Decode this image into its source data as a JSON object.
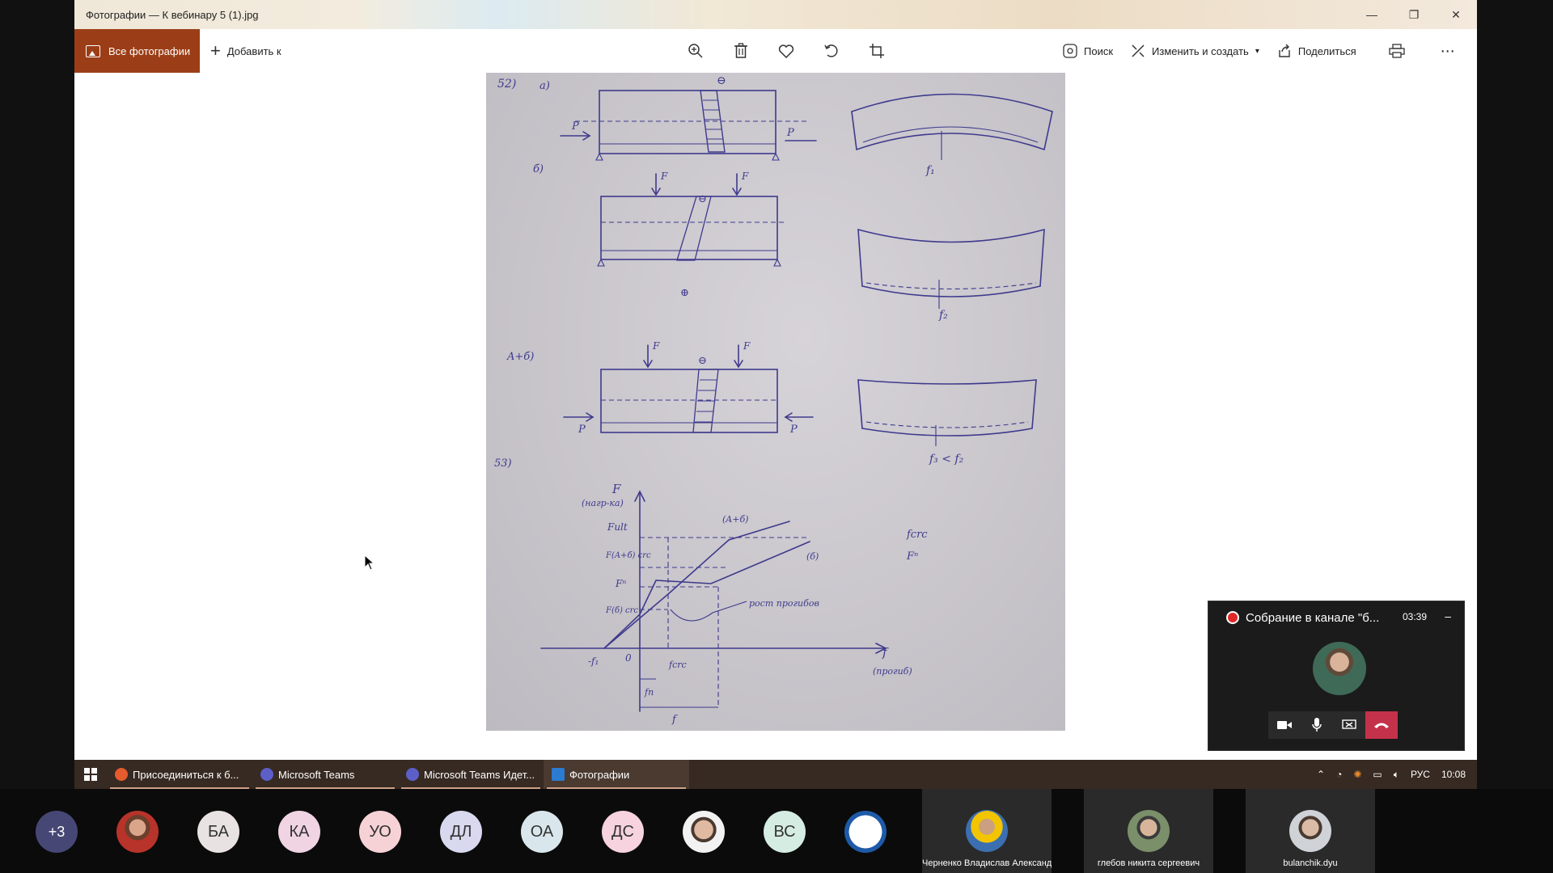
{
  "window": {
    "title": "Фотографии — К вебинару 5 (1).jpg",
    "controls": [
      "—",
      "❐",
      "✕"
    ]
  },
  "toolbar": {
    "all_photos_label": "Все фотографии",
    "add_to_label": "Добавить к",
    "search_label": "Поиск",
    "edit_create_label": "Изменить и создать",
    "share_label": "Поделиться"
  },
  "photo": {
    "labels": {
      "n52": "52)",
      "a": "a)",
      "b": "б)",
      "ab": "A+б)",
      "n53": "53)",
      "theta": "⊖",
      "plus": "⊕",
      "P": "P",
      "F": "F",
      "f1": "f₁",
      "f2": "f₂",
      "f3f2": "f₃ < f₂",
      "axis_F": "F",
      "axis_F_note": "(нагр-ка)",
      "Fult": "Fult",
      "Fcrc_ab": "F(A+б) crc",
      "Fn": "Fⁿ",
      "Fcrc_b": "F(б) crc",
      "ab_curve": "(A+б)",
      "b_curve": "(б)",
      "rost": "рост прогибов",
      "axis_f": "f",
      "axis_f_note": "(прогиб)",
      "minus_f1": "-f₁",
      "zero": "0",
      "fcrc": "fcrc",
      "fn": "fn",
      "f_bottom": "f",
      "side_fcrc": "fcrc",
      "side_Fn": "Fⁿ"
    }
  },
  "taskbar": {
    "items": [
      {
        "label": "Присоединиться к б...",
        "color": "#e55b2d"
      },
      {
        "label": "Microsoft Teams",
        "color": "#5b5fc7"
      },
      {
        "label": "Microsoft Teams Идет...",
        "color": "#5b5fc7"
      },
      {
        "label": "Фотографии",
        "color": "#2b7bd0"
      }
    ],
    "tray": {
      "lang": "РУС",
      "time": "10:08"
    }
  },
  "teams_call": {
    "title": "Собрание в канале \"б...",
    "timer": "03:39",
    "minimize": "–"
  },
  "participants": {
    "more": "+3",
    "initials": [
      {
        "text": "БА",
        "bg": "#e8e2e2"
      },
      {
        "text": "КА",
        "bg": "#f0d4e4"
      },
      {
        "text": "УО",
        "bg": "#f6d2d6"
      },
      {
        "text": "ДЛ",
        "bg": "#d8d8ef"
      },
      {
        "text": "ОА",
        "bg": "#d9e7ec"
      },
      {
        "text": "ДС",
        "bg": "#f6d3df"
      },
      {
        "text": "ВС",
        "bg": "#d5ece2"
      }
    ],
    "tiles": [
      {
        "name": "Черненко Владислав Александро..."
      },
      {
        "name": "глебов никита сергеевич"
      },
      {
        "name": "bulanchik.dyu"
      }
    ]
  }
}
